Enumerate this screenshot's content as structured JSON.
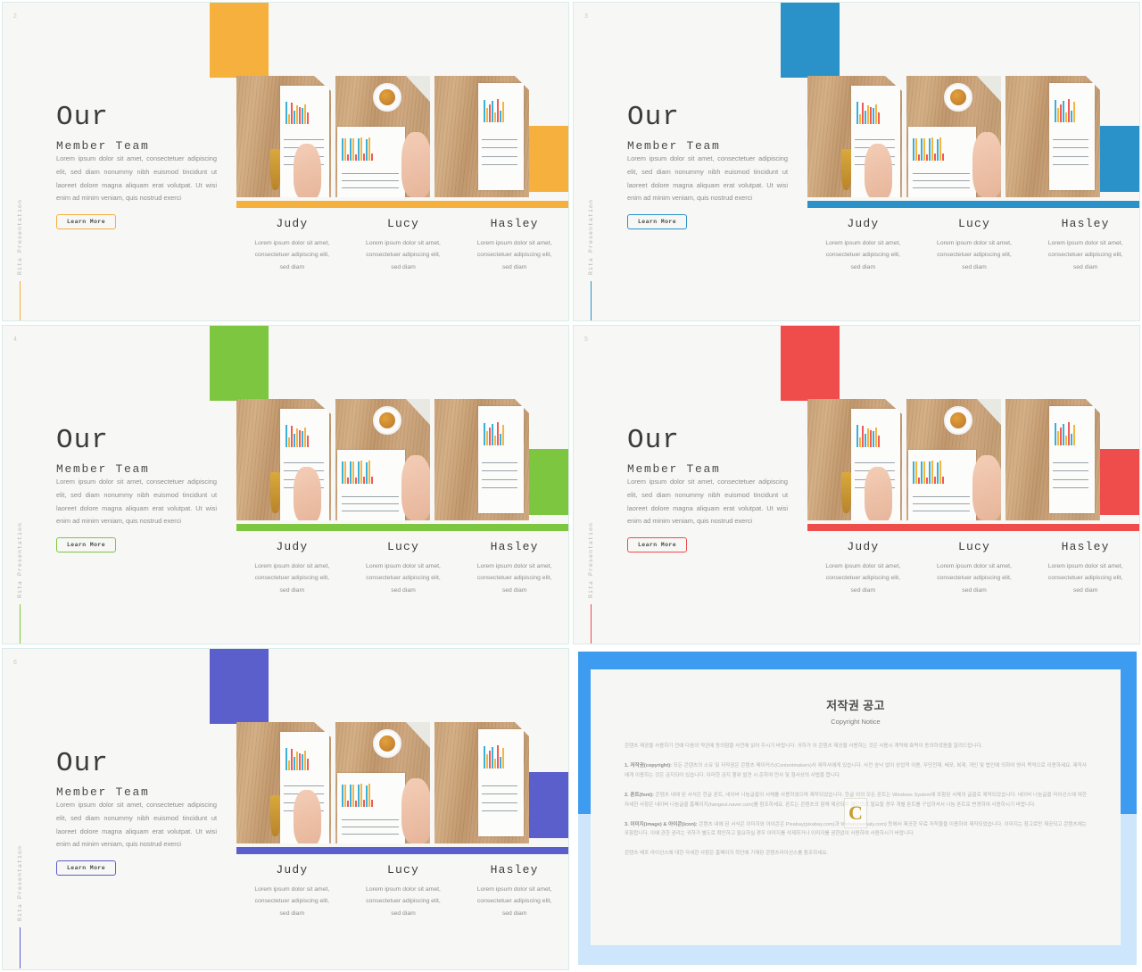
{
  "deck": {
    "brand_vertical": "Rita Presentation",
    "heading_main": "Our",
    "heading_sub": "Member Team",
    "body_copy": "Lorem ipsum dolor sit amet, consectetuer adipiscing elit, sed diam nonummy nibh euismod tincidunt ut laoreet dolore magna aliquam erat volutpat. Ut wisi enim ad minim veniam, quis nostrud exerci",
    "learn_more_label": "Learn More",
    "member_desc": "Lorem ipsum dolor sit amet, consectetuer adipiscing elit, sed diam",
    "members": [
      "Judy",
      "Lucy",
      "Hasley"
    ]
  },
  "slides": [
    {
      "number": "2",
      "accent": "#F5B03E"
    },
    {
      "number": "3",
      "accent": "#2B92C9"
    },
    {
      "number": "4",
      "accent": "#7DC740"
    },
    {
      "number": "5",
      "accent": "#EF4C4C"
    },
    {
      "number": "6",
      "accent": "#5B5FCC"
    }
  ],
  "copyright": {
    "title": "저작권 공고",
    "subtitle": "Copyright Notice",
    "intro": "콘텐츠 제공물 사용하기 전에 다음의 약관에 동의함을 사전에 읽어 주시기 바랍니다. 귀하가 이 콘텐츠 제공물 사용하는 것은 사용시 계약에 효력이 동의하셨음을 알려드립니다.",
    "section1_label": "1. 저작권(copyright):",
    "section1_body": "모든 콘텐츠의 소유 및 저작권은 콘텐츠 메이커스(Contentmakers)사 제작사에게 있습니다. 사전 승낙 없이 상업적 이용, 무단전재, 배포, 복제, 개인 및 법인에 의하여 영리 목적으로 이용하세요. 제작사에게 이용하는 것은 금지되어 있습니다. 이러한 금지 행위 발견 시 준하여 민사 및 형사상의 사법을 합니다.",
    "section2_label": "2. 폰트(font):",
    "section2_body": "콘텐츠 내에 된 서식은 한글 폰트, 네이버 나눔글꼴의 서체를 사용하였으며 제작되었습니다. 한글 외의 모든 폰트는 Windows System에 포함된 서체의 글꼴로 제작되었습니다. 네이버 나눔글꼴 라이선스에 대한 자세한 사항은 네이버 나눔글꼴 홈페이지(hangeul.naver.com)를 참조하세요. 폰트는 콘텐츠의 함께 제공되지 않으므로 필요할 경우 개별 폰트를 구입하셔서 나눔 폰트로 변경하여 사용하시기 바랍니다.",
    "section3_label": "3. 이미지(image) & 아이콘(icon):",
    "section3_body": "콘텐츠 내에 된 서식은 이미지와 아이콘은 Pixabay(pixabay.com)과 Webaly(webaly.com) 등에서 제공한 무료 저작물을 이용하여 제작되었습니다. 이미지는 참고로만 제공되고 콘텐츠에는 포함합니다. 이에 관한 권리는 귀하가 별도로 확인하고 필요하실 경우 이미지를 삭제하거나 이미지를 권한없이 사용하여 사용하시기 바랍니다.",
    "footer": "콘텐츠 배포 라이선스에 대한 자세한 사항은 홈페이지 하단에 기재된 콘텐츠라이선스를 참조하세요.",
    "mark_letter": "C",
    "band_dark_color": "#3D9BF0",
    "band_light_color": "#CDE6FB"
  }
}
